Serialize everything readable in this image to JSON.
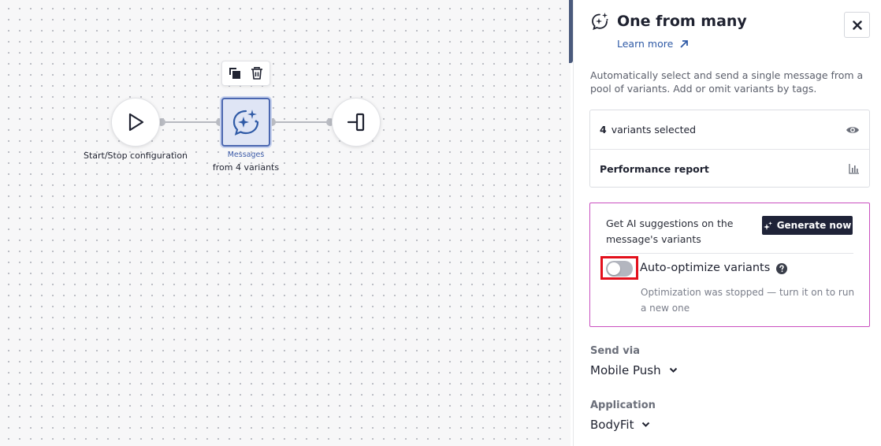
{
  "canvas": {
    "start_node": {
      "label": "Start/Stop configuration"
    },
    "messages_node": {
      "type_label": "Messages",
      "sub_label": "from 4 variants"
    }
  },
  "panel": {
    "title": "One from many",
    "learn_more": "Learn more",
    "description": "Automatically select and send a single message from a pool of variants. Add or omit variants by tags.",
    "variants": {
      "count": "4",
      "label": "variants selected"
    },
    "performance_report": "Performance report",
    "ai": {
      "text": "Get AI suggestions on the message's variants",
      "generate_button": "Generate now",
      "toggle_label": "Auto-optimize variants",
      "toggle_on": false,
      "status": "Optimization was stopped — turn it on to run a new one"
    },
    "send_via": {
      "label": "Send via",
      "value": "Mobile Push"
    },
    "application": {
      "label": "Application",
      "value": "BodyFit"
    }
  },
  "colors": {
    "accent": "#2f5aa6",
    "ai_border": "#c94fbf",
    "highlight": "#e3101c",
    "dark_button": "#1f2338"
  }
}
